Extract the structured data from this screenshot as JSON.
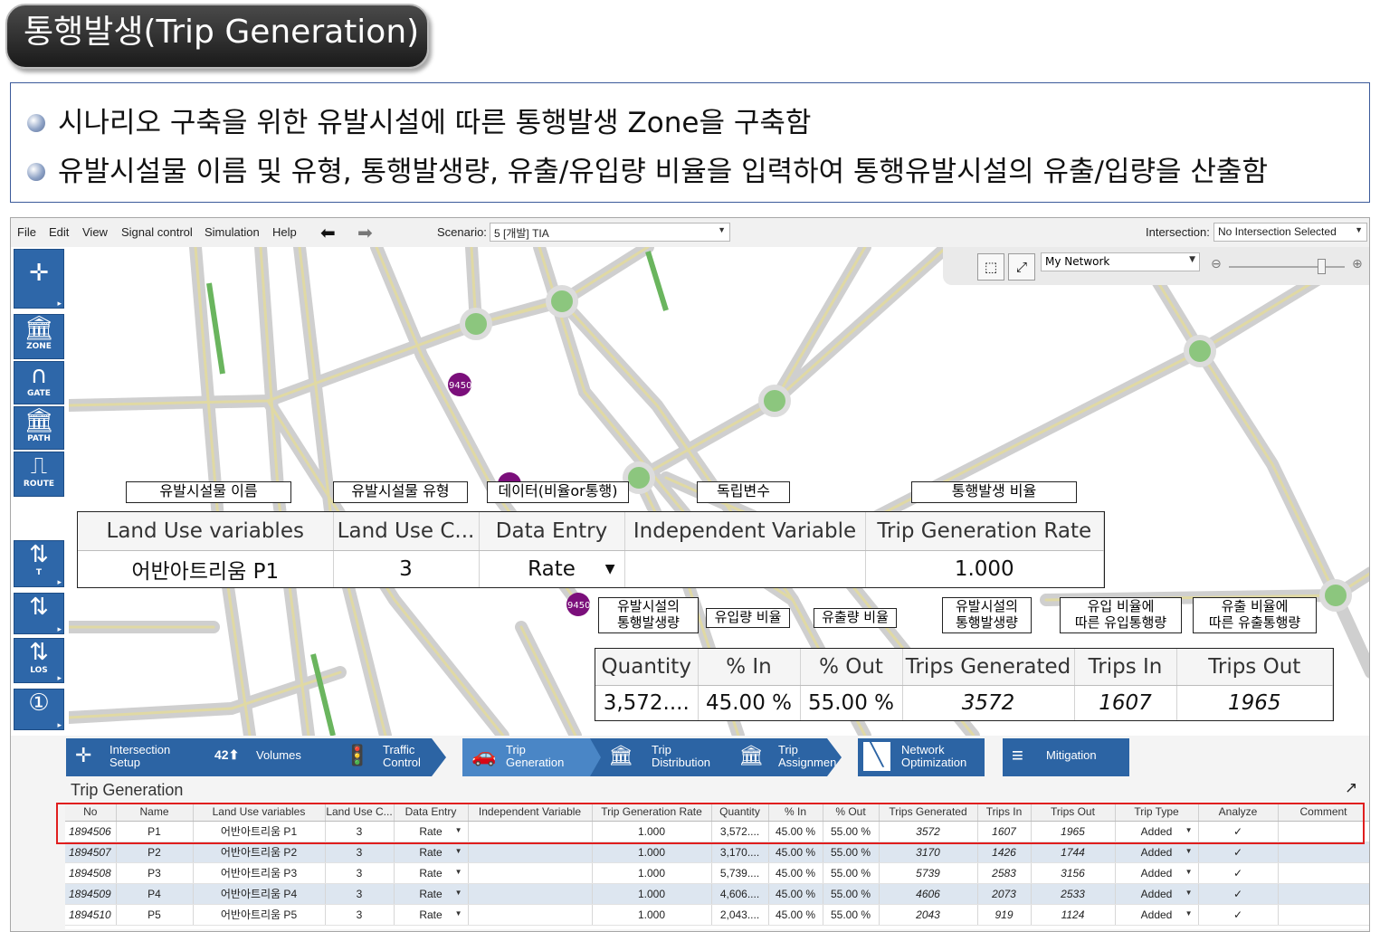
{
  "title": "통행발생(Trip  Generation)",
  "description": [
    "시나리오 구축을 위한 유발시설에 따른 통행발생 Zone을 구축함",
    "유발시설물 이름 및 유형, 통행발생량, 유출/유입량 비율을 입력하여 통행유발시설의 유출/입량을 산출함"
  ],
  "menubar": {
    "items": [
      "File",
      "Edit",
      "View",
      "Signal control",
      "Simulation",
      "Help"
    ],
    "scenario_label": "Scenario:",
    "scenario_value": "5 [개발] TIA",
    "intersection_label": "Intersection:",
    "intersection_value": "No Intersection Selected"
  },
  "left_toolbar": {
    "zone": "ZONE",
    "gate": "GATE",
    "path": "PATH",
    "route": "ROUTE",
    "t": "T",
    "los": "LOS"
  },
  "map": {
    "network_value": "My Network",
    "zone_label": "9450"
  },
  "annotations": {
    "land_use_name": "유발시설물 이름",
    "land_use_type": "유발시설물 유형",
    "data_entry": "데이터(비율or통행)",
    "independent": "독립변수",
    "rate": "통행발생 비율",
    "quantity": "유발시설의\n통행발생량",
    "pct_in": "유입량 비율",
    "pct_out": "유출량 비율",
    "trips_generated": "유발시설의\n통행발생량",
    "trips_in": "유입 비율에\n따른 유입통행량",
    "trips_out": "유출 비율에\n따른 유출통행량"
  },
  "zoom_table_top": {
    "headers": [
      "Land Use variables",
      "Land Use C...",
      "Data Entry",
      "Independent Variable",
      "Trip Generation Rate"
    ],
    "row": [
      "어반아트리움 P1",
      "3",
      "Rate",
      "",
      "1.000"
    ]
  },
  "zoom_table_bottom": {
    "headers": [
      "Quantity",
      "% In",
      "% Out",
      "Trips Generated",
      "Trips In",
      "Trips Out"
    ],
    "row": [
      "3,572....",
      "45.00 %",
      "55.00 %",
      "3572",
      "1607",
      "1965"
    ]
  },
  "workflow": [
    {
      "icon": "intersection-setup-icon",
      "label": "Intersection\nSetup"
    },
    {
      "icon": "volumes-icon",
      "badge": "42",
      "label": "Volumes"
    },
    {
      "icon": "traffic-light-icon",
      "label": "Traffic\nControl"
    },
    {
      "icon": "trip-generation-icon",
      "label": "Trip\nGeneration"
    },
    {
      "icon": "trip-distribution-icon",
      "label": "Trip\nDistribution"
    },
    {
      "icon": "trip-assignment-icon",
      "label": "Trip\nAssignmen"
    },
    {
      "icon": "network-optimization-icon",
      "label": "Network\nOptimization"
    },
    {
      "icon": "mitigation-icon",
      "label": "Mitigation"
    }
  ],
  "grid": {
    "title": "Trip Generation",
    "headers": [
      "No",
      "Name",
      "Land Use variables",
      "Land Use C...",
      "Data Entry",
      "Independent Variable",
      "Trip Generation Rate",
      "Quantity",
      "% In",
      "% Out",
      "Trips Generated",
      "Trips In",
      "Trips Out",
      "Trip Type",
      "Analyze",
      "Comment"
    ],
    "rows": [
      [
        "1894506",
        "P1",
        "어반아트리움 P1",
        "3",
        "Rate",
        "",
        "1.000",
        "3,572....",
        "45.00 %",
        "55.00 %",
        "3572",
        "1607",
        "1965",
        "Added",
        "✓",
        ""
      ],
      [
        "1894507",
        "P2",
        "어반아트리움 P2",
        "3",
        "Rate",
        "",
        "1.000",
        "3,170....",
        "45.00 %",
        "55.00 %",
        "3170",
        "1426",
        "1744",
        "Added",
        "✓",
        ""
      ],
      [
        "1894508",
        "P3",
        "어반아트리움 P3",
        "3",
        "Rate",
        "",
        "1.000",
        "5,739....",
        "45.00 %",
        "55.00 %",
        "5739",
        "2583",
        "3156",
        "Added",
        "✓",
        ""
      ],
      [
        "1894509",
        "P4",
        "어반아트리움 P4",
        "3",
        "Rate",
        "",
        "1.000",
        "4,606....",
        "45.00 %",
        "55.00 %",
        "4606",
        "2073",
        "2533",
        "Added",
        "✓",
        ""
      ],
      [
        "1894510",
        "P5",
        "어반아트리움 P5",
        "3",
        "Rate",
        "",
        "1.000",
        "2,043....",
        "45.00 %",
        "55.00 %",
        "2043",
        "919",
        "1124",
        "Added",
        "✓",
        ""
      ]
    ]
  },
  "colors": {
    "accent": "#2c64a4",
    "road_center": "#e0d9a4",
    "roundabout": "#8cc67e",
    "zone_marker": "#7b0f7b",
    "highlight": "#e01e1e",
    "alt_row": "#dde6f0"
  }
}
